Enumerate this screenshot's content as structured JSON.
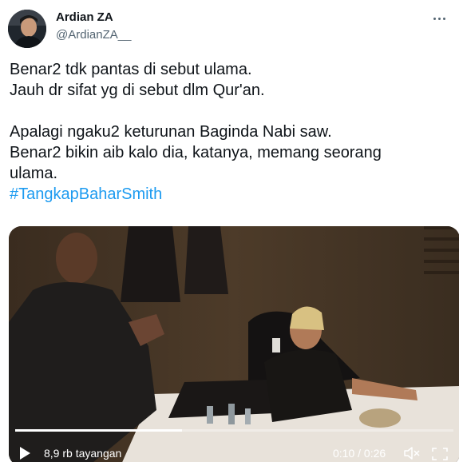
{
  "author": {
    "name": "Ardian ZA",
    "handle": "@ArdianZA__"
  },
  "tweet": {
    "lines": [
      "Benar2 tdk pantas di sebut ulama.",
      "Jauh dr sifat yg di sebut dlm Qur'an.",
      "Apalagi ngaku2 keturunan Baginda Nabi saw.",
      "Benar2 bikin aib kalo dia, katanya,  memang seorang",
      "ulama."
    ],
    "hashtag": "#TangkapBaharSmith"
  },
  "video": {
    "views": "8,9 rb tayangan",
    "time": "0:10 / 0:26",
    "progress": 0.38
  },
  "icons": {
    "more": "more-options-icon",
    "play": "play-icon",
    "volume": "volume-muted-icon",
    "fullscreen": "fullscreen-icon"
  }
}
